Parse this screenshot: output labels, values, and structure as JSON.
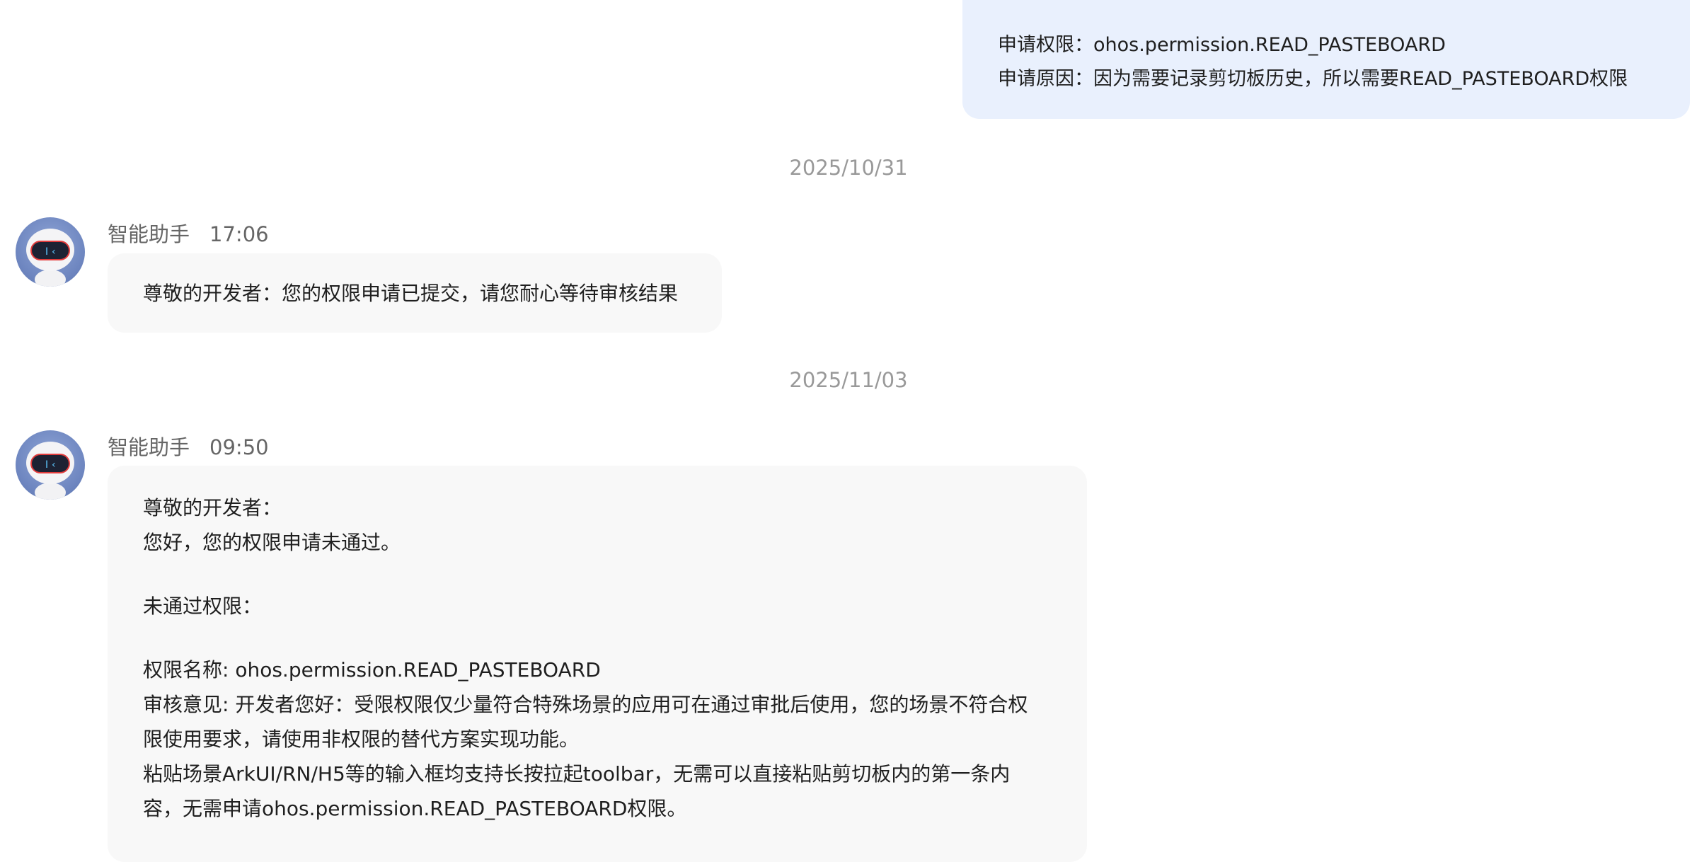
{
  "user_request": {
    "permission_line": "申请权限：ohos.permission.READ_PASTEBOARD",
    "reason_line": "申请原因：因为需要记录剪切板历史，所以需要READ_PASTEBOARD权限"
  },
  "messages": [
    {
      "date": "2025/10/31",
      "sender": "智能助手",
      "time": "17:06",
      "lines": [
        "尊敬的开发者：您的权限申请已提交，请您耐心等待审核结果"
      ]
    },
    {
      "date": "2025/11/03",
      "sender": "智能助手",
      "time": "09:50",
      "lines": [
        "尊敬的开发者：",
        "您好，您的权限申请未通过。",
        "",
        "未通过权限：",
        "",
        "权限名称: ohos.permission.READ_PASTEBOARD",
        "审核意见: 开发者您好：受限权限仅少量符合特殊场景的应用可在通过审批后使用，您的场景不符合权",
        "限使用要求，请使用非权限的替代方案实现功能。",
        "粘贴场景ArkUI/RN/H5等的输入框均支持长按拉起toolbar，无需可以直接粘贴剪切板内的第一条内",
        "容，无需申请ohos.permission.READ_PASTEBOARD权限。"
      ]
    }
  ],
  "colors": {
    "user_bubble": "#e9f0fd",
    "assistant_bubble": "#f8f8f8",
    "date_text": "#999999",
    "meta_text": "#666666"
  },
  "icons": [
    "assistant-robot-avatar"
  ]
}
